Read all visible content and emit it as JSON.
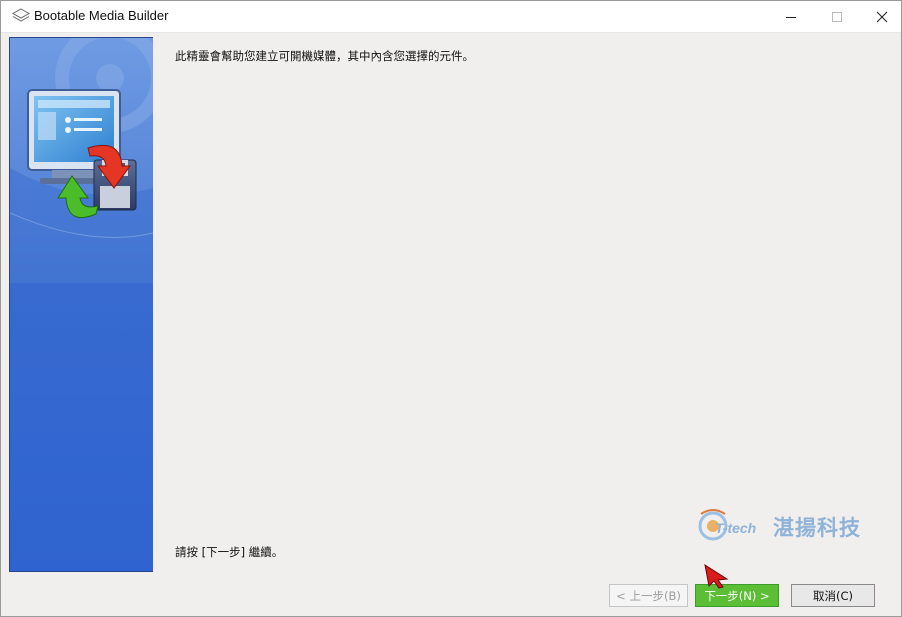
{
  "window": {
    "title": "Bootable Media Builder",
    "controls": [
      "minimize-icon",
      "maximize-icon",
      "close-icon"
    ]
  },
  "content": {
    "intro": "此精靈會幫助您建立可開機媒體，其中內含您選擇的元件。",
    "continue_hint": "請按 [下一步] 繼續。"
  },
  "buttons": {
    "back": "< 上一步(B)",
    "next": "下一步(N) >",
    "cancel": "取消(C)"
  },
  "watermark": {
    "brand_tech": "T-tech",
    "brand_name": "湛揚科技"
  },
  "colors": {
    "side_panel": "#3a6cd0",
    "next_button": "#5cbe34",
    "watermark": "#8fb3d8"
  }
}
